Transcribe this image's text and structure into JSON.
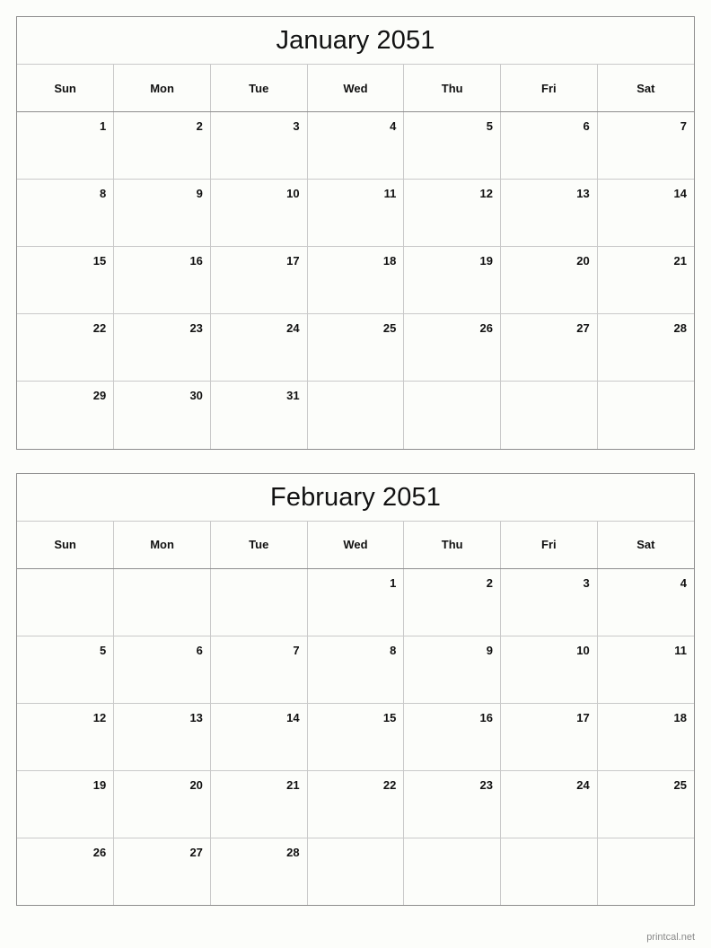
{
  "site": {
    "footer_label": "printcal.net"
  },
  "colors": {
    "page_background": "#fcfdfa",
    "outer_border": "#8d8d8d",
    "grid_line": "#c9c9c9",
    "text": "#111111",
    "footer_text": "#8a8a8a"
  },
  "weekday_headers": [
    "Sun",
    "Mon",
    "Tue",
    "Wed",
    "Thu",
    "Fri",
    "Sat"
  ],
  "months": [
    {
      "title": "January 2051",
      "name": "January",
      "year": "2051",
      "weeks": [
        [
          "",
          "",
          "",
          "",
          "",
          "",
          ""
        ],
        [
          "1",
          "2",
          "3",
          "4",
          "5",
          "6",
          "7"
        ],
        [
          "8",
          "9",
          "10",
          "11",
          "12",
          "13",
          "14"
        ],
        [
          "15",
          "16",
          "17",
          "18",
          "19",
          "20",
          "21"
        ],
        [
          "22",
          "23",
          "24",
          "25",
          "26",
          "27",
          "28"
        ],
        [
          "29",
          "30",
          "31",
          "",
          "",
          "",
          ""
        ]
      ]
    },
    {
      "title": "February 2051",
      "name": "February",
      "year": "2051",
      "weeks": [
        [
          "",
          "",
          "",
          "1",
          "2",
          "3",
          "4"
        ],
        [
          "5",
          "6",
          "7",
          "8",
          "9",
          "10",
          "11"
        ],
        [
          "12",
          "13",
          "14",
          "15",
          "16",
          "17",
          "18"
        ],
        [
          "19",
          "20",
          "21",
          "22",
          "23",
          "24",
          "25"
        ],
        [
          "26",
          "27",
          "28",
          "",
          "",
          "",
          ""
        ]
      ]
    }
  ]
}
